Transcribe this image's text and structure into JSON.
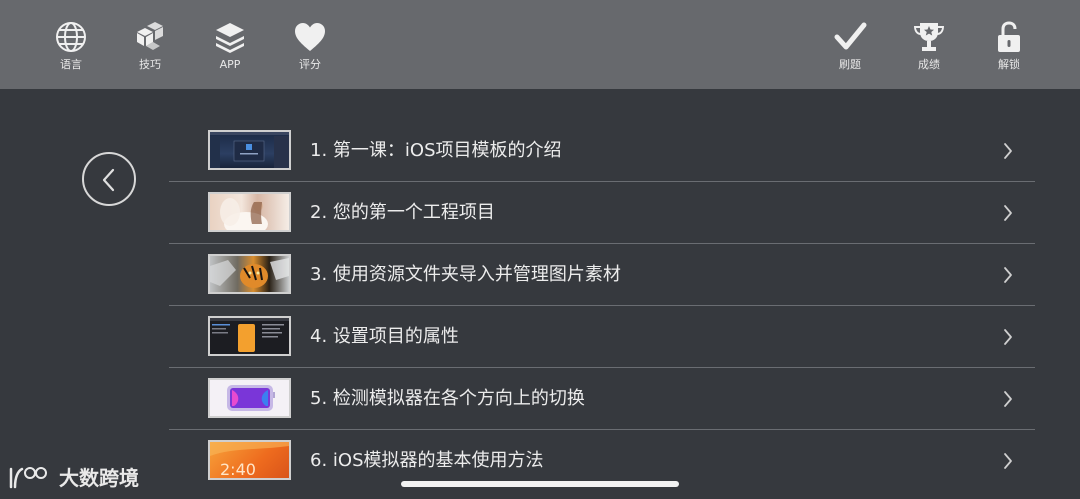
{
  "toolbar": {
    "left": [
      {
        "label": "语言",
        "icon": "globe-icon"
      },
      {
        "label": "技巧",
        "icon": "cubes-icon"
      },
      {
        "label": "APP",
        "icon": "layers-icon"
      },
      {
        "label": "评分",
        "icon": "heart-icon"
      }
    ],
    "right": [
      {
        "label": "刷题",
        "icon": "check-icon"
      },
      {
        "label": "成绩",
        "icon": "trophy-icon"
      },
      {
        "label": "解锁",
        "icon": "unlock-icon"
      }
    ]
  },
  "lessons": [
    {
      "title": "1. 第一课：iOS项目模板的介绍"
    },
    {
      "title": "2. 您的第一个工程项目"
    },
    {
      "title": "3. 使用资源文件夹导入并管理图片素材"
    },
    {
      "title": "4. 设置项目的属性"
    },
    {
      "title": "5. 检测模拟器在各个方向上的切换"
    },
    {
      "title": "6. iOS模拟器的基本使用方法"
    }
  ],
  "thumb6_time": "2:40",
  "watermark": {
    "text": "大数跨境"
  },
  "colors": {
    "topbar": "#67696d",
    "background": "#36393e",
    "divider": "#6a6d72"
  }
}
